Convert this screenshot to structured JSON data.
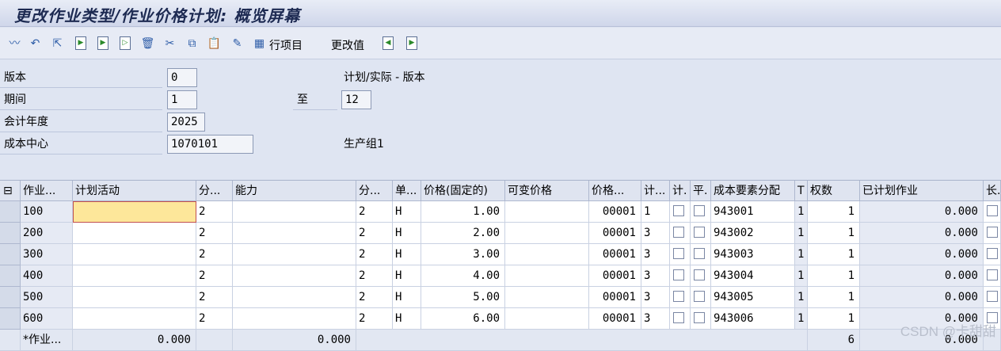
{
  "window": {
    "title": "更改作业类型/作业价格计划: 概览屏幕"
  },
  "toolbar": {
    "line_items_label": "行项目",
    "change_values_label": "更改值"
  },
  "header": {
    "version_label": "版本",
    "version_value": "0",
    "version_desc": "计划/实际 - 版本",
    "period_label": "期间",
    "period_from": "1",
    "period_to_label": "至",
    "period_to": "12",
    "fiscal_year_label": "会计年度",
    "fiscal_year": "2025",
    "cost_center_label": "成本中心",
    "cost_center": "1070101",
    "cost_center_desc": "生产组1"
  },
  "table": {
    "columns": [
      "作业...",
      "计划活动",
      "分...",
      "能力",
      "分...",
      "单...",
      "价格(固定的)",
      "可变价格",
      "价格...",
      "计...",
      "计.",
      "平.",
      "成本要素分配",
      "T",
      "权数",
      "已计划作业",
      "长."
    ],
    "rows": [
      {
        "activity": "100",
        "plan": "",
        "dist1": "2",
        "capacity": "",
        "dist2": "2",
        "unit": "H",
        "fixed_price": "1.00",
        "var_price": "",
        "price_unit": "00001",
        "plan_ind": "1",
        "cost_element": "943001",
        "t": "1",
        "weight": "1",
        "planned": "0.000"
      },
      {
        "activity": "200",
        "plan": "",
        "dist1": "2",
        "capacity": "",
        "dist2": "2",
        "unit": "H",
        "fixed_price": "2.00",
        "var_price": "",
        "price_unit": "00001",
        "plan_ind": "3",
        "cost_element": "943002",
        "t": "1",
        "weight": "1",
        "planned": "0.000"
      },
      {
        "activity": "300",
        "plan": "",
        "dist1": "2",
        "capacity": "",
        "dist2": "2",
        "unit": "H",
        "fixed_price": "3.00",
        "var_price": "",
        "price_unit": "00001",
        "plan_ind": "3",
        "cost_element": "943003",
        "t": "1",
        "weight": "1",
        "planned": "0.000"
      },
      {
        "activity": "400",
        "plan": "",
        "dist1": "2",
        "capacity": "",
        "dist2": "2",
        "unit": "H",
        "fixed_price": "4.00",
        "var_price": "",
        "price_unit": "00001",
        "plan_ind": "3",
        "cost_element": "943004",
        "t": "1",
        "weight": "1",
        "planned": "0.000"
      },
      {
        "activity": "500",
        "plan": "",
        "dist1": "2",
        "capacity": "",
        "dist2": "2",
        "unit": "H",
        "fixed_price": "5.00",
        "var_price": "",
        "price_unit": "00001",
        "plan_ind": "3",
        "cost_element": "943005",
        "t": "1",
        "weight": "1",
        "planned": "0.000"
      },
      {
        "activity": "600",
        "plan": "",
        "dist1": "2",
        "capacity": "",
        "dist2": "2",
        "unit": "H",
        "fixed_price": "6.00",
        "var_price": "",
        "price_unit": "00001",
        "plan_ind": "3",
        "cost_element": "943006",
        "t": "1",
        "weight": "1",
        "planned": "0.000"
      }
    ],
    "total": {
      "label": "*作业...",
      "plan": "0.000",
      "capacity": "0.000",
      "weight": "6",
      "planned": "0.000"
    }
  },
  "watermark": "CSDN @卡甜甜"
}
